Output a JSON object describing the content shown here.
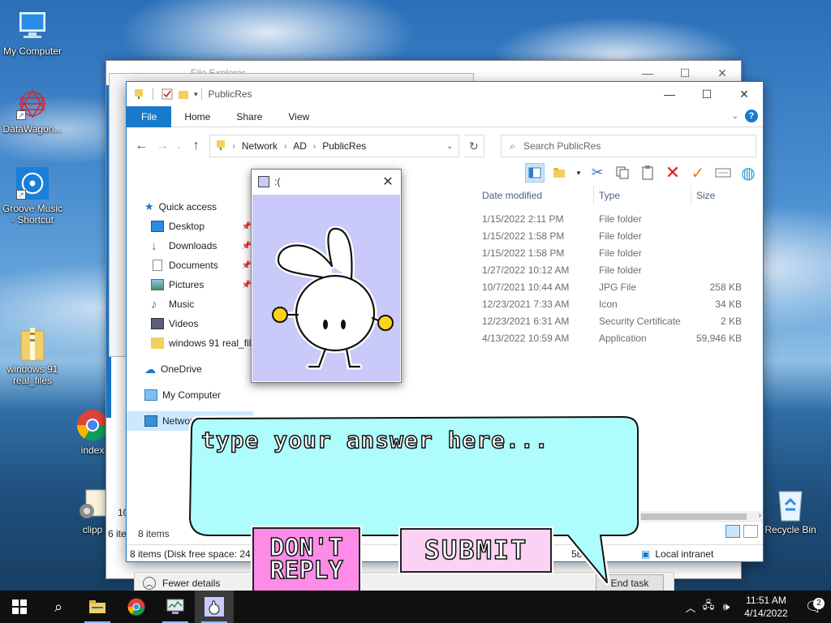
{
  "desktop": {
    "icons": [
      {
        "label": "My Computer"
      },
      {
        "label": "DataWagon..."
      },
      {
        "label": "Groove Music - Shortcut"
      },
      {
        "label": "windows 91 real_files"
      },
      {
        "label": "index"
      },
      {
        "label": "clipp"
      },
      {
        "label": "Recycle Bin"
      }
    ]
  },
  "back_window": {
    "title": "File Explorer",
    "left_fragments": [
      "10",
      "6 ite"
    ]
  },
  "explorer": {
    "title": "PublicRes",
    "ribbon_tabs": [
      "File",
      "Home",
      "Share",
      "View"
    ],
    "breadcrumb": [
      "Network",
      "AD",
      "PublicRes"
    ],
    "search_placeholder": "Search PublicRes",
    "nav": {
      "quick_access": "Quick access",
      "items": [
        "Desktop",
        "Downloads",
        "Documents",
        "Pictures",
        "Music",
        "Videos",
        "windows 91 real_file"
      ],
      "onedrive": "OneDrive",
      "my_computer": "My Computer",
      "network": "Network"
    },
    "columns": {
      "date": "Date modified",
      "type": "Type",
      "size": "Size"
    },
    "files": [
      {
        "date": "1/15/2022 2:11 PM",
        "type": "File folder",
        "size": ""
      },
      {
        "date": "1/15/2022 1:58 PM",
        "type": "File folder",
        "size": ""
      },
      {
        "date": "1/15/2022 1:58 PM",
        "type": "File folder",
        "size": ""
      },
      {
        "date": "1/27/2022 10:12 AM",
        "type": "File folder",
        "size": ""
      },
      {
        "date": "10/7/2021 10:44 AM",
        "type": "JPG File",
        "size": "258 KB"
      },
      {
        "date": "12/23/2021 7:33 AM",
        "type": "Icon",
        "size": "34 KB"
      },
      {
        "date": "12/23/2021 6:31 AM",
        "type": "Security Certificate",
        "size": "2 KB"
      },
      {
        "date": "4/13/2022 10:59 AM",
        "type": "Application",
        "size": "59,946 KB"
      }
    ],
    "item_count": "8 items",
    "status_details": "8 items (Disk free space: 24.0",
    "status_size": "58.",
    "zone": "Local intranet"
  },
  "task_manager": {
    "fewer_details": "Fewer details",
    "end_task": "End task"
  },
  "popup": {
    "title": ":("
  },
  "bubble": {
    "placeholder": "type your answer here..."
  },
  "buttons": {
    "dont_reply": "DON'T REPLY",
    "submit": "SUBMIT"
  },
  "taskbar": {
    "time": "11:51 AM",
    "date": "4/14/2022",
    "notification_count": "2"
  },
  "colors": {
    "accent": "#1979ca",
    "bubble": "#aefcfc",
    "popup_bg": "#c9c9fa",
    "dont_reply": "#ff8be8",
    "submit": "#fcd2f4"
  }
}
